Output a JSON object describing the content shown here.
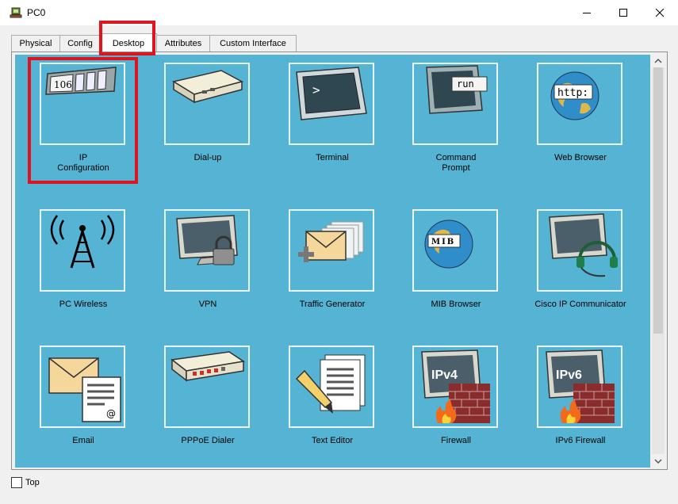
{
  "window": {
    "title": "PC0"
  },
  "tabs": [
    {
      "label": "Physical"
    },
    {
      "label": "Config"
    },
    {
      "label": "Desktop",
      "active": true
    },
    {
      "label": "Attributes"
    },
    {
      "label": "Custom Interface"
    }
  ],
  "apps": [
    {
      "label": "IP\nConfiguration",
      "icon": "ip-configuration-icon",
      "badge": "106"
    },
    {
      "label": "Dial-up",
      "icon": "modem-icon"
    },
    {
      "label": "Terminal",
      "icon": "terminal-icon",
      "prompt": ">"
    },
    {
      "label": "Command\nPrompt",
      "icon": "command-prompt-icon",
      "badge": "run"
    },
    {
      "label": "Web Browser",
      "icon": "globe-icon",
      "badge": "http:"
    },
    {
      "label": "PC Wireless",
      "icon": "wireless-tower-icon"
    },
    {
      "label": "VPN",
      "icon": "monitor-lock-icon"
    },
    {
      "label": "Traffic Generator",
      "icon": "envelopes-plus-icon"
    },
    {
      "label": "MIB Browser",
      "icon": "mib-globe-icon",
      "badge": "MIB"
    },
    {
      "label": "Cisco IP Communicator",
      "icon": "monitor-headset-icon"
    },
    {
      "label": "Email",
      "icon": "email-icon",
      "badge": "@"
    },
    {
      "label": "PPPoE Dialer",
      "icon": "pppoe-modem-icon"
    },
    {
      "label": "Text Editor",
      "icon": "text-editor-icon"
    },
    {
      "label": "Firewall",
      "icon": "firewall-icon",
      "badge": "IPv4"
    },
    {
      "label": "IPv6 Firewall",
      "icon": "firewall-icon",
      "badge": "IPv6"
    }
  ],
  "footer": {
    "top_label": "Top",
    "top_checked": false
  },
  "colors": {
    "desktop_bg": "#55b3d3",
    "highlight": "#e0141e"
  }
}
